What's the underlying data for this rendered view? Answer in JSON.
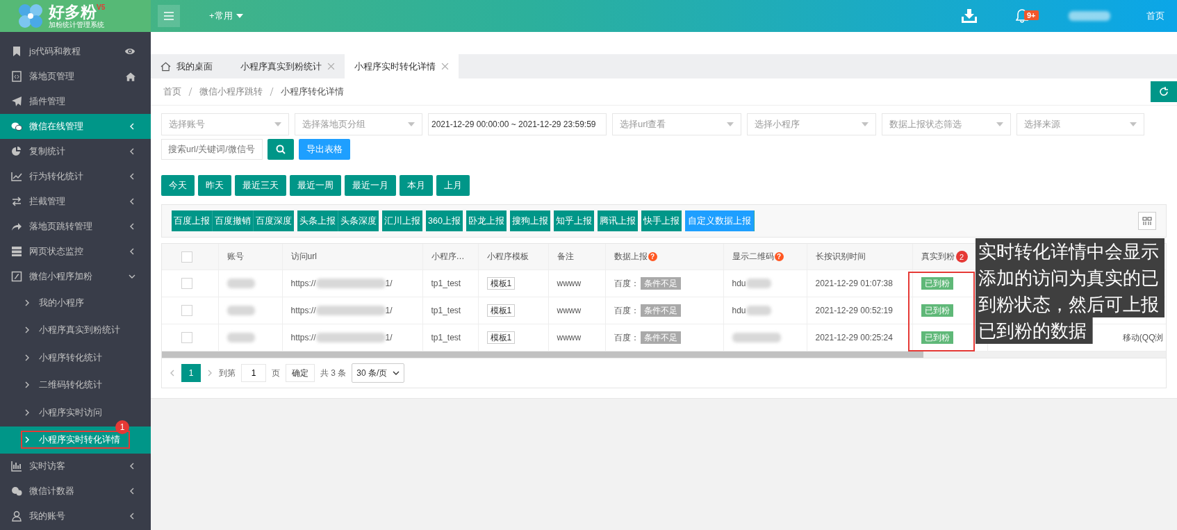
{
  "header": {
    "logo_text": "好多粉",
    "logo_version": "V5",
    "logo_subtitle": "加粉统计管理系统",
    "menu_label": "+常用",
    "notification_badge": "9+",
    "home_link": "首页"
  },
  "sidebar": {
    "items": [
      {
        "label": "js代码和教程",
        "selected": false
      },
      {
        "label": "落地页管理",
        "selected": false
      },
      {
        "label": "插件管理",
        "selected": false
      },
      {
        "label": "微信在线管理",
        "selected": true,
        "expanded": false
      },
      {
        "label": "复制统计",
        "selected": false,
        "expanded": false
      },
      {
        "label": "行为转化统计",
        "selected": false,
        "expanded": false
      },
      {
        "label": "拦截管理",
        "selected": false,
        "expanded": false
      },
      {
        "label": "落地页跳转管理",
        "selected": false,
        "expanded": false
      },
      {
        "label": "网页状态监控",
        "selected": false,
        "expanded": false
      },
      {
        "label": "微信小程序加粉",
        "selected": false,
        "expanded": true,
        "children": [
          {
            "label": "我的小程序",
            "selected": false
          },
          {
            "label": "小程序真实到粉统计",
            "selected": false
          },
          {
            "label": "小程序转化统计",
            "selected": false
          },
          {
            "label": "二维码转化统计",
            "selected": false
          },
          {
            "label": "小程序实时访问",
            "selected": false
          },
          {
            "label": "小程序实时转化详情",
            "selected": true,
            "highlighted": true,
            "callout_badge": "1"
          }
        ]
      },
      {
        "label": "实时访客",
        "selected": false,
        "expanded": false
      },
      {
        "label": "微信计数器",
        "selected": false,
        "expanded": false
      },
      {
        "label": "我的账号",
        "selected": false,
        "expanded": false
      }
    ]
  },
  "tabs": [
    {
      "label": "我的桌面",
      "selected": false,
      "closable": false
    },
    {
      "label": "小程序真实到粉统计",
      "selected": false,
      "closable": true
    },
    {
      "label": "小程序实时转化详情",
      "selected": true,
      "closable": true
    }
  ],
  "breadcrumb": [
    "首页",
    "微信小程序跳转",
    "小程序转化详情"
  ],
  "filters": [
    {
      "kind": "select",
      "placeholder": "选择账号"
    },
    {
      "kind": "select",
      "placeholder": "选择落地页分组"
    },
    {
      "kind": "date",
      "value": "2021-12-29 00:00:00 ~ 2021-12-29 23:59:59"
    },
    {
      "kind": "select",
      "placeholder": "选择url查看"
    },
    {
      "kind": "select",
      "placeholder": "选择小程序"
    },
    {
      "kind": "select",
      "placeholder": "数据上报状态筛选"
    },
    {
      "kind": "select",
      "placeholder": "选择来源"
    }
  ],
  "search": {
    "placeholder": "搜索url/关键词/微信号",
    "export_button": "导出表格"
  },
  "date_buttons": [
    "今天",
    "昨天",
    "最近三天",
    "最近一周",
    "最近一月",
    "本月",
    "上月"
  ],
  "report_button_groups": [
    [
      "百度上报",
      "百度撤销",
      "百度深度"
    ],
    [
      "头条上报",
      "头条深度"
    ],
    [
      "汇川上报"
    ],
    [
      "360上报"
    ],
    [
      "卧龙上报"
    ],
    [
      "搜狗上报"
    ],
    [
      "知乎上报"
    ],
    [
      "腾讯上报"
    ],
    [
      "快手上报"
    ]
  ],
  "custom_report_button": "自定义数据上报",
  "table": {
    "select_all_checked": false,
    "columns": [
      {
        "label": "账号"
      },
      {
        "label": "访问url"
      },
      {
        "label": "小程序…"
      },
      {
        "label": "小程序模板"
      },
      {
        "label": "备注"
      },
      {
        "label": "数据上报",
        "help": "?"
      },
      {
        "label": "显示二维码",
        "help": "?"
      },
      {
        "label": "长按识别时间"
      },
      {
        "label": "真实到粉",
        "highlighted": true,
        "callout_badge": "2"
      }
    ],
    "rows": [
      {
        "checked": false,
        "url_start": "https://",
        "url_end": "1/",
        "program": "tp1_test",
        "template": "模板1",
        "note": "wwww",
        "report_label": "百度：",
        "report_status": "条件不足",
        "qr": "hdu",
        "time": "2021-12-29 01:07:38",
        "real_fan": "已到粉"
      },
      {
        "checked": false,
        "url_start": "https://",
        "url_end": "1/",
        "program": "tp1_test",
        "template": "模板1",
        "note": "wwww",
        "report_label": "百度：",
        "report_status": "条件不足",
        "qr": "hdu",
        "time": "2021-12-29 00:52:19",
        "real_fan": "已到粉"
      },
      {
        "checked": false,
        "url_start": "https://",
        "url_end": "1/",
        "program": "tp1_test",
        "template": "模板1",
        "note": "wwww",
        "report_label": "百度：",
        "report_status": "条件不足",
        "time": "2021-12-29 00:25:24",
        "real_fan": "已到粉",
        "extra": "移动(QQ浏"
      }
    ]
  },
  "pager": {
    "pages": [
      {
        "label": "1",
        "selected": true
      }
    ],
    "goto_label": "到第",
    "goto_value": "1",
    "page_unit": "页",
    "confirm": "确定",
    "total": "共 3 条",
    "page_size": "30 条/页"
  },
  "callout": "实时转化详情中会显示添加的访问为真实的已到粉状态，然后可上报已到粉的数据"
}
